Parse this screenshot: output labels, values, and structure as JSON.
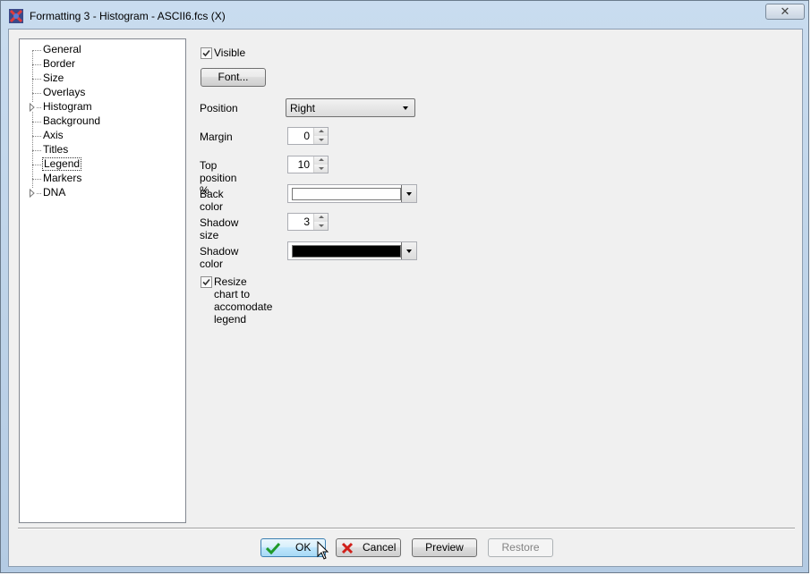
{
  "window": {
    "title": "Formatting 3 - Histogram - ASCII6.fcs (X)",
    "close_glyph": "✕"
  },
  "tree": {
    "items": [
      {
        "label": "General",
        "expandable": false
      },
      {
        "label": "Border",
        "expandable": false
      },
      {
        "label": "Size",
        "expandable": false
      },
      {
        "label": "Overlays",
        "expandable": false
      },
      {
        "label": "Histogram",
        "expandable": true
      },
      {
        "label": "Background",
        "expandable": false
      },
      {
        "label": "Axis",
        "expandable": false
      },
      {
        "label": "Titles",
        "expandable": false
      },
      {
        "label": "Legend",
        "expandable": false,
        "selected": true
      },
      {
        "label": "Markers",
        "expandable": false
      },
      {
        "label": "DNA",
        "expandable": true
      }
    ]
  },
  "legend": {
    "visible_label": "Visible",
    "visible_checked": true,
    "font_button": "Font...",
    "position_label": "Position",
    "position_value": "Right",
    "margin_label": "Margin",
    "margin_value": "0",
    "top_position_label": "Top position %",
    "top_position_value": "10",
    "back_color_label": "Back color",
    "back_color": "#ffffff",
    "shadow_size_label": "Shadow size",
    "shadow_size_value": "3",
    "shadow_color_label": "Shadow color",
    "shadow_color": "#000000",
    "resize_label": "Resize chart to accomodate legend",
    "resize_checked": true
  },
  "buttons": {
    "ok": "OK",
    "cancel": "Cancel",
    "preview": "Preview",
    "restore": "Restore"
  }
}
